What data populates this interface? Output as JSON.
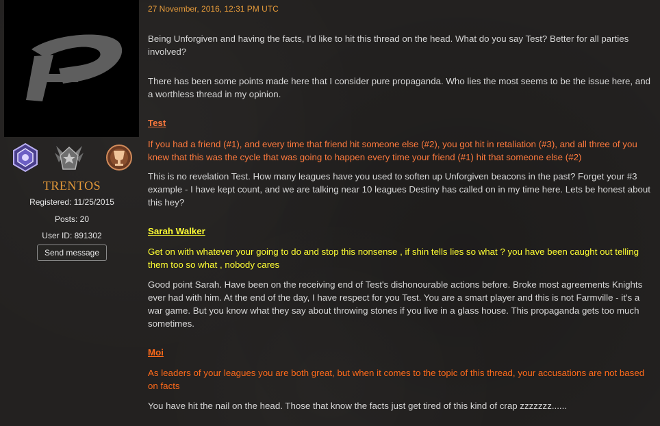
{
  "profile": {
    "username": "TRENTOS",
    "registered": "Registered: 11/25/2015",
    "posts": "Posts: 20",
    "user_id": "User ID: 891302",
    "send_message_label": "Send message",
    "avatar_icon": "stylized-p-logo-icon",
    "badges": [
      "purple-rank-badge-icon",
      "silver-star-rank-badge-icon",
      "bronze-trophy-badge-icon"
    ]
  },
  "post": {
    "date": "27 November, 2016, 12:31 PM UTC",
    "intro_1": "Being Unforgiven and having the facts, I'd like to hit this thread on the head. What do you say Test? Better for all parties involved?",
    "intro_2": "There has been some points made here that I consider pure propaganda. Who lies the most seems to be the issue here, and a worthless thread in my opinion.",
    "quotes": [
      {
        "author": "Test",
        "color": "#ff7a3d",
        "text": "If you had a friend (#1), and every time that friend hit someone else (#2), you got hit in retaliation (#3), and all three of you knew that this was the cycle that was going to happen every time your friend (#1) hit that someone else (#2)",
        "reply": "This is no revelation Test. How many leagues have you used to soften up Unforgiven beacons in the past? Forget your #3 example - I have kept count, and we are talking near 10 leagues Destiny has called on in my time here. Lets be honest about this hey?"
      },
      {
        "author": "Sarah Walker",
        "color": "#ffff33",
        "text": "Get on with whatever your going to do and stop this nonsense , if shin tells lies so what ? you have been caught out telling them too so what , nobody cares",
        "reply": "Good point Sarah. Have been on the receiving end of Test's dishonourable actions before. Broke most agreements Knights ever had with him. At the end of the day, I have respect for you Test. You are a smart player and this is not Farmville - it's a war game. But you know what they say about throwing stones if you live in a glass house. This propaganda gets too much sometimes."
      },
      {
        "author": "Moi",
        "color": "#ff6a1a",
        "text": "As leaders of your leagues you are both great, but when it comes to the topic of this thread, your accusations are not based on facts",
        "reply": "You have hit the nail on the head. Those that know the facts just get tired of this kind of crap zzzzzzz......"
      }
    ]
  }
}
